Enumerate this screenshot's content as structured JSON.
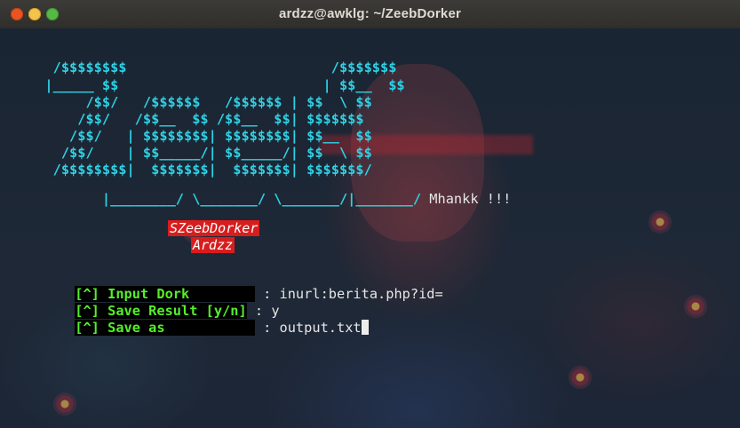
{
  "window": {
    "title": "ardzz@awklg: ~/ZeebDorker"
  },
  "banner": {
    "lines": [
      "   /$$$$$$$$                         /$$$$$$$",
      "  |_____ $$                         | $$__  $$",
      "       /$$/   /$$$$$$   /$$$$$$ | $$  \\ $$",
      "      /$$/   /$$__  $$ /$$__  $$| $$$$$$$",
      "     /$$/   | $$$$$$$$| $$$$$$$$| $$__  $$",
      "    /$$/    | $$_____/| $$_____/| $$  \\ $$",
      "   /$$$$$$$$|  $$$$$$$|  $$$$$$$| $$$$$$$/",
      "   |________/ \\_______/ \\_______/|_______/"
    ],
    "suffix": " Mhankk !!!"
  },
  "credits": {
    "tool_name": "SZeebDorker",
    "author": "Ardzz"
  },
  "prompts": [
    {
      "label": "[^] Input Dork        ",
      "separator": " : ",
      "value": "inurl:berita.php?id="
    },
    {
      "label": "[^] Save Result [y/n]",
      "separator": " : ",
      "value": "y"
    },
    {
      "label": "[^] Save as           ",
      "separator": " : ",
      "value": "output.txt"
    }
  ],
  "colors": {
    "banner": "#2fd2e6",
    "prompt_label": "#55ee2a",
    "tag_background": "#d81d1d",
    "titlebar": "#3c3b37"
  }
}
